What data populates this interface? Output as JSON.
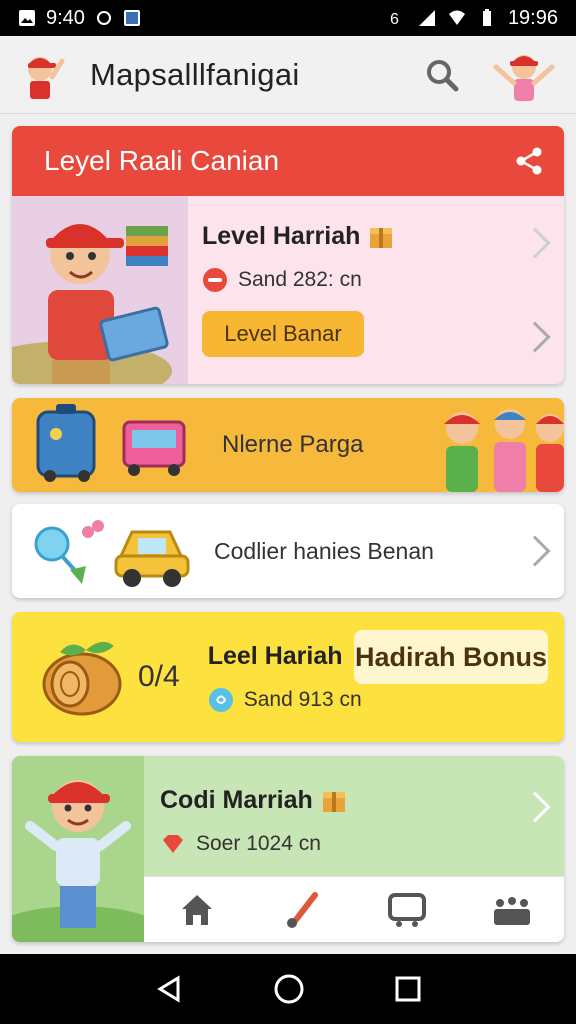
{
  "status_bar": {
    "time": "9:40",
    "right_time": "19:96"
  },
  "app_bar": {
    "title": "Mapsalllfanigai"
  },
  "card1": {
    "header": "Leyel Raali Canian",
    "title": "Level Harriah",
    "subtitle": "Sand 282: cn",
    "button": "Level Banar"
  },
  "card2": {
    "label": "Nlerne Parga"
  },
  "card3": {
    "label": "Codlier hanies Benan"
  },
  "card4": {
    "score": "0/4",
    "title": "Leel Hariah",
    "subtitle": "Sand 913 cn",
    "badge": "Hadirah Bonus"
  },
  "card5": {
    "title": "Codi Marriah",
    "subtitle": "Soer 1024 cn"
  },
  "colors": {
    "red_header": "#e9483c",
    "orange": "#f7b733",
    "yellow": "#fce13f",
    "green": "#c8e6b5"
  },
  "icons": [
    "search-icon",
    "share-icon",
    "gift-box-icon",
    "home-icon",
    "brush-icon",
    "screen-icon",
    "group-icon"
  ]
}
